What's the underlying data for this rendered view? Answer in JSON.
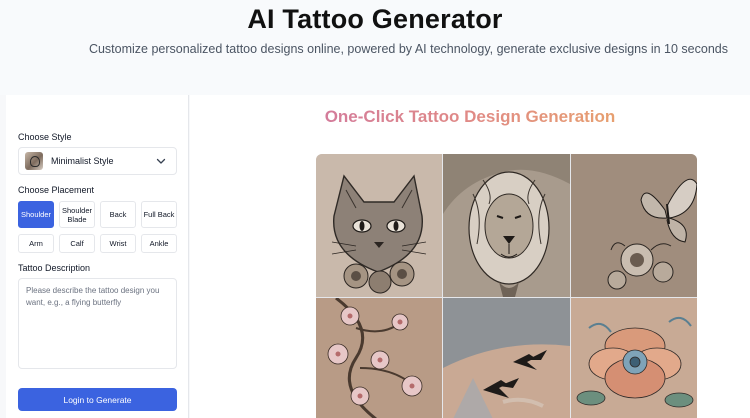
{
  "header": {
    "title": "AI Tattoo Generator",
    "subtitle": "Customize personalized tattoo designs online, powered by AI technology, generate exclusive designs in 10 seconds"
  },
  "form": {
    "style_label": "Choose Style",
    "style_selected": "Minimalist Style",
    "style_icon": "chevron-down-icon",
    "placement_label": "Choose Placement",
    "placements": [
      "Shoulder",
      "Shoulder Blade",
      "Back",
      "Full Back",
      "Arm",
      "Calf",
      "Wrist",
      "Ankle"
    ],
    "placement_selected": "Shoulder",
    "description_label": "Tattoo Description",
    "description_placeholder": "Please describe the tattoo design you want, e.g., a flying butterfly",
    "generate_label": "Login to Generate"
  },
  "showcase": {
    "title": "One-Click Tattoo Design Generation",
    "images": [
      "cat-tattoo",
      "lion-tattoo",
      "butterfly-tattoo",
      "cherry-blossom-tattoo",
      "swallows-tattoo",
      "flower-tattoo"
    ]
  },
  "colors": {
    "primary": "#3b63e0",
    "title_gradient_start": "#c86fae",
    "title_gradient_end": "#eeb35a"
  }
}
